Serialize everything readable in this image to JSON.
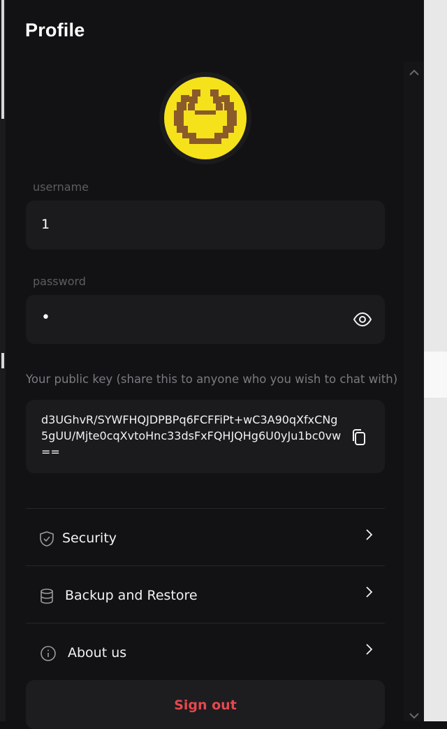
{
  "page": {
    "title": "Profile"
  },
  "username": {
    "label": "username",
    "value": "1"
  },
  "password": {
    "label": "password",
    "value": "•"
  },
  "public_key": {
    "label": "Your public key (share this to anyone who you wish to chat with)",
    "value": "d3UGhvR/SYWFHQJDPBPq6FCFFiPt+wC3A90qXfxCNg5gUU/Mjte0cqXvtoHnc33dsFxFQHJQHg6U0yJu1bc0vw=="
  },
  "menu": [
    {
      "label": "Security",
      "icon": "shield-check-icon"
    },
    {
      "label": "Backup and Restore",
      "icon": "database-icon"
    },
    {
      "label": "About us",
      "icon": "info-icon"
    }
  ],
  "sign_out": {
    "label": "Sign out"
  },
  "colors": {
    "background": "#121214",
    "card": "#1b1b1e",
    "danger": "#e5484d",
    "avatar_yellow": "#f5e21b",
    "avatar_brown": "#8a5a2b"
  }
}
